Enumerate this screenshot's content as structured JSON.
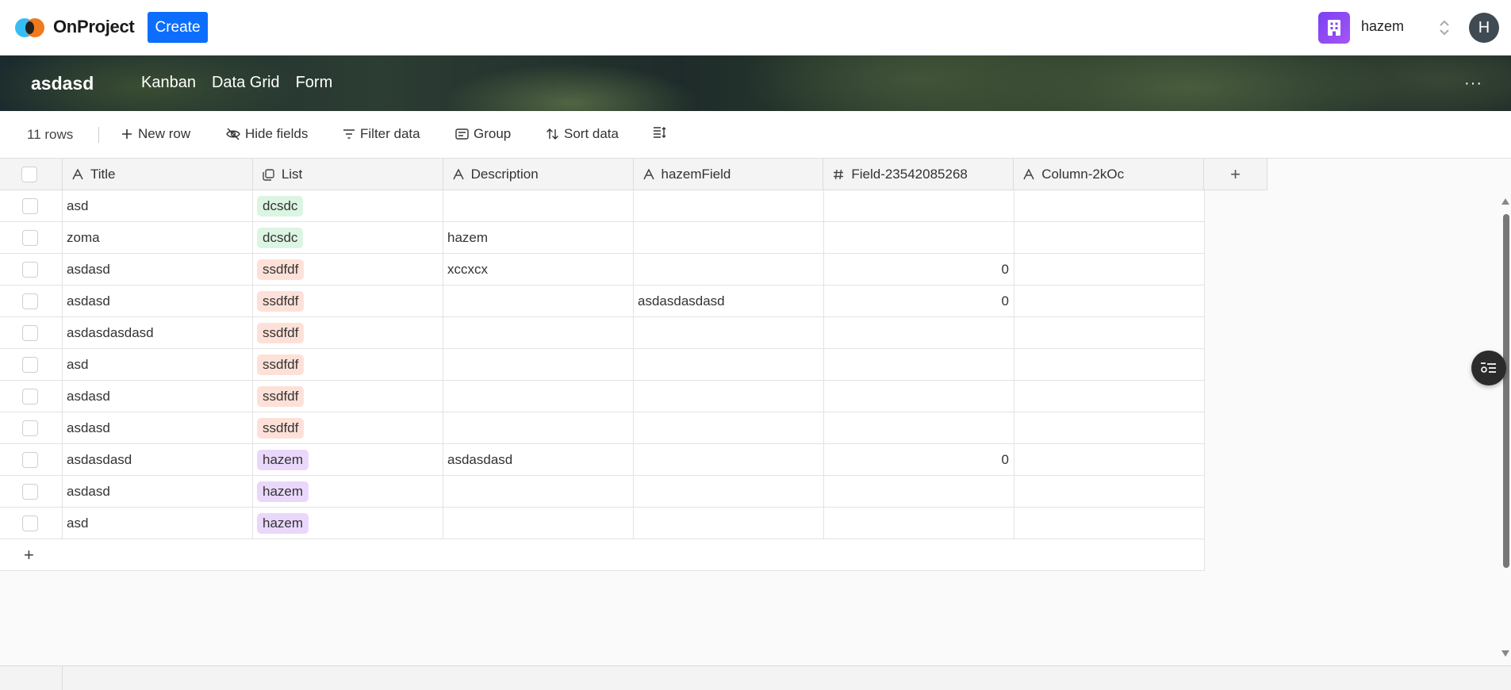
{
  "app": {
    "name": "OnProject",
    "create_label": "Create"
  },
  "workspace": {
    "name": "hazem",
    "avatar_initial": "H",
    "icon": "building-icon",
    "accent": "#7b3ff2"
  },
  "board": {
    "title": "asdasd",
    "views": [
      {
        "label": "Kanban"
      },
      {
        "label": "Data Grid"
      },
      {
        "label": "Form"
      }
    ],
    "more_label": "···"
  },
  "toolbar": {
    "row_count": "11 rows",
    "new_row": "New row",
    "hide_fields": "Hide fields",
    "filter": "Filter data",
    "group": "Group",
    "sort": "Sort data"
  },
  "columns": [
    {
      "label": "Title",
      "icon": "text-icon"
    },
    {
      "label": "List",
      "icon": "list-icon"
    },
    {
      "label": "Description",
      "icon": "text-icon"
    },
    {
      "label": "hazemField",
      "icon": "text-icon"
    },
    {
      "label": "Field-23542085268",
      "icon": "hash-icon"
    },
    {
      "label": "Column-2kOc",
      "icon": "text-icon"
    }
  ],
  "tag_colors": {
    "dcsdc": "#dcf5e3",
    "ssdfdf": "#fde1d8",
    "hazem": "#ead8fb"
  },
  "rows": [
    {
      "title": "asd",
      "list": "dcsdc",
      "description": "",
      "hazemField": "",
      "field": "",
      "column": ""
    },
    {
      "title": "zoma",
      "list": "dcsdc",
      "description": "hazem",
      "hazemField": "",
      "field": "",
      "column": ""
    },
    {
      "title": "asdasd",
      "list": "ssdfdf",
      "description": "xccxcx",
      "hazemField": "",
      "field": "0",
      "column": ""
    },
    {
      "title": "asdasd",
      "list": "ssdfdf",
      "description": "",
      "hazemField": "asdasdasdasd",
      "field": "0",
      "column": ""
    },
    {
      "title": "asdasdasdasd",
      "list": "ssdfdf",
      "description": "",
      "hazemField": "",
      "field": "",
      "column": ""
    },
    {
      "title": "asd",
      "list": "ssdfdf",
      "description": "",
      "hazemField": "",
      "field": "",
      "column": ""
    },
    {
      "title": "asdasd",
      "list": "ssdfdf",
      "description": "",
      "hazemField": "",
      "field": "",
      "column": ""
    },
    {
      "title": "asdasd",
      "list": "ssdfdf",
      "description": "",
      "hazemField": "",
      "field": "",
      "column": ""
    },
    {
      "title": "asdasdasd",
      "list": "hazem",
      "description": "asdasdasd",
      "hazemField": "",
      "field": "0",
      "column": ""
    },
    {
      "title": "asdasd",
      "list": "hazem",
      "description": "",
      "hazemField": "",
      "field": "",
      "column": ""
    },
    {
      "title": "asd",
      "list": "hazem",
      "description": "",
      "hazemField": "",
      "field": "",
      "column": ""
    }
  ]
}
